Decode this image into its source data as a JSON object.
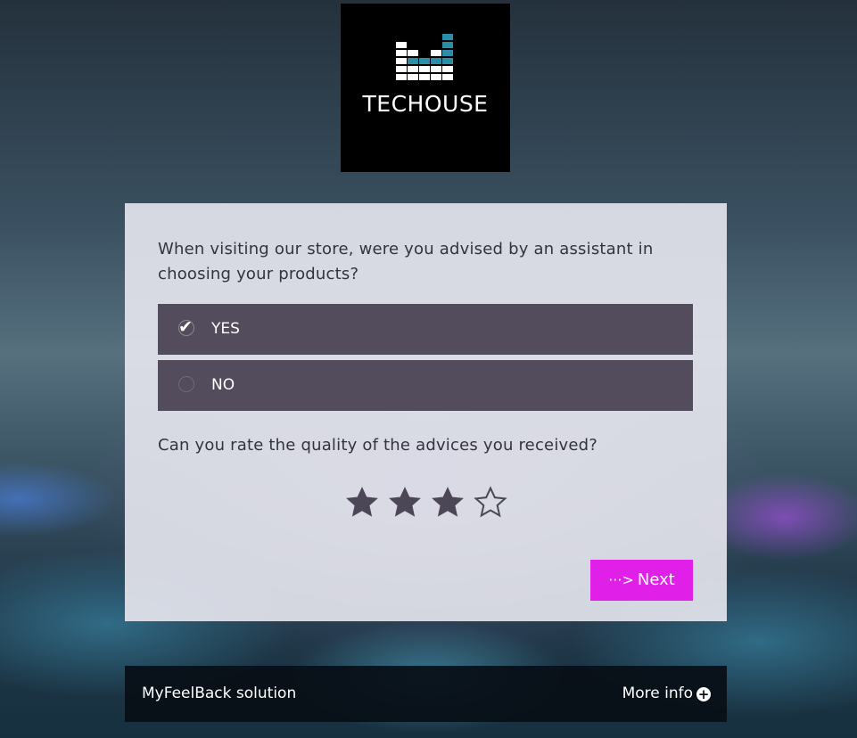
{
  "logo": {
    "text": "TECHOUSE",
    "colors": {
      "white": "#ffffff",
      "teal": "#2a8ea8",
      "background": "#000000"
    }
  },
  "survey": {
    "question1": "When visiting our store, were you advised by an assistant in choosing your products?",
    "options": [
      {
        "label": "YES",
        "selected": true
      },
      {
        "label": "NO",
        "selected": false
      }
    ],
    "question2": "Can you rate the quality of the advices you received?",
    "rating": {
      "value": 3,
      "max": 5
    },
    "next_arrow": "···>",
    "next_label": "Next"
  },
  "footer": {
    "brand": "MyFeelBack solution",
    "more_info": "More info",
    "plus_icon": "+"
  },
  "colors": {
    "accent": "#e020e8",
    "option_bg": "#534c5c",
    "text": "#333340"
  }
}
